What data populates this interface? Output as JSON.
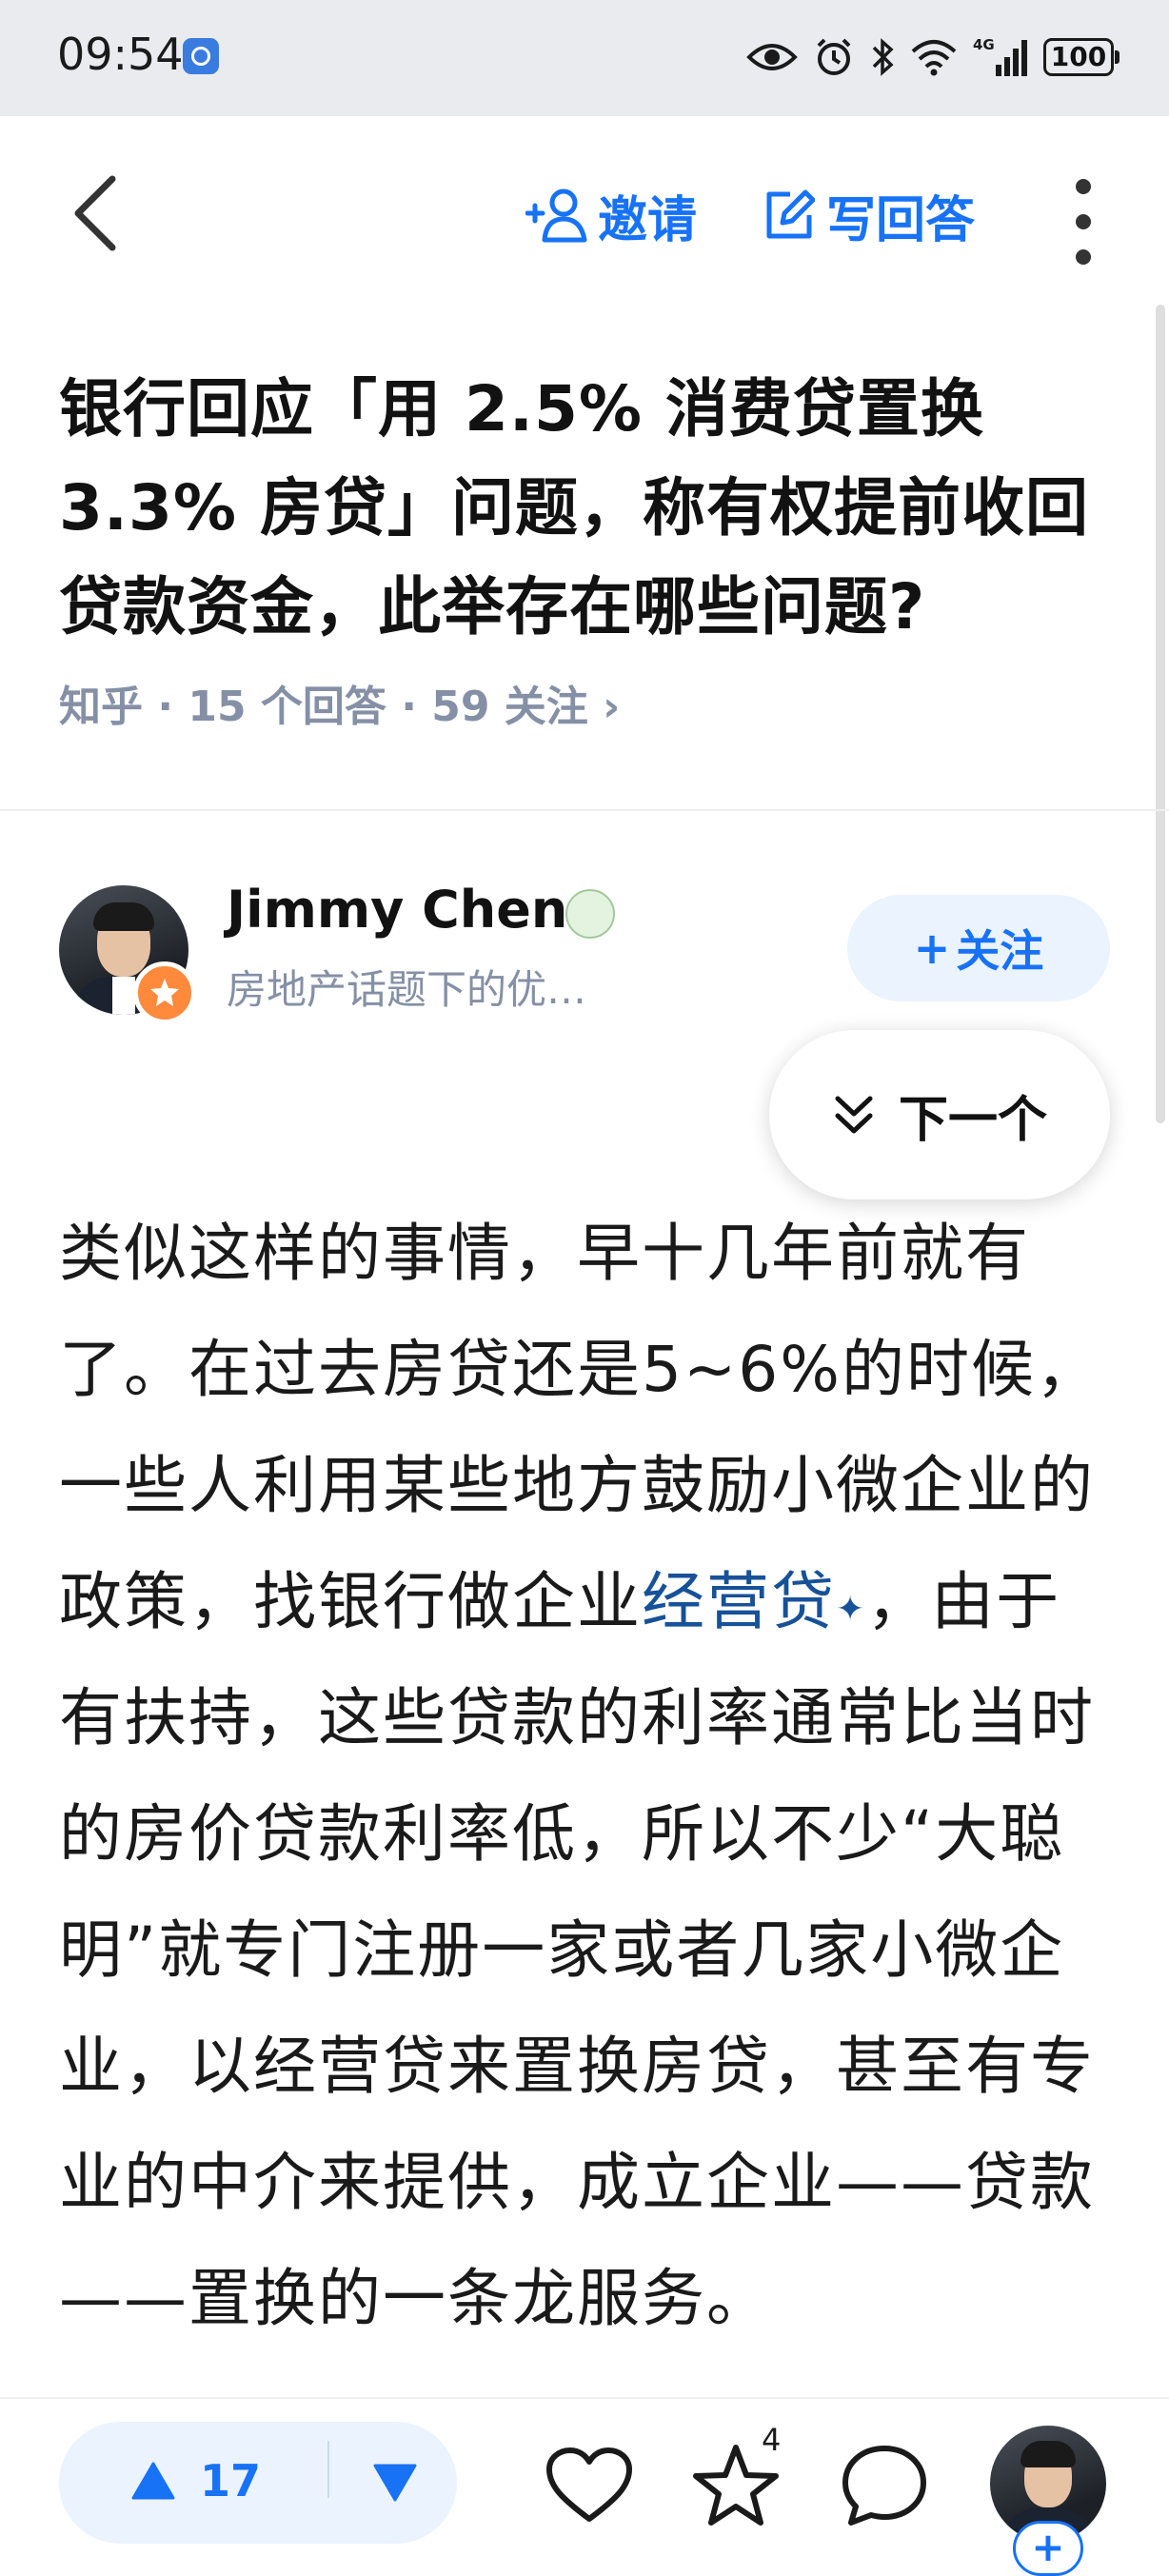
{
  "status_bar": {
    "time": "09:54",
    "signal_label": "4G",
    "battery": "100"
  },
  "nav": {
    "invite_label": "邀请",
    "write_answer_label": "写回答"
  },
  "question": {
    "title": "银行回应「用 2.5% 消费贷置换 3.3% 房贷」问题，称有权提前收回贷款资金，此举存在哪些问题?",
    "meta": "知乎 · 15 个回答 · 59 关注 ›"
  },
  "author": {
    "name": "Jimmy Chen",
    "description": "房地产话题下的优…",
    "follow_label": "关注",
    "follow_prefix": "+"
  },
  "next_button": {
    "label": "下一个"
  },
  "answer": {
    "text_before_link": "类似这样的事情，早十几年前就有了。在过去房贷还是5~6%的时候，一些人利用某些地方鼓励小微企业的政策，找银行做企业",
    "link_text": "经营贷",
    "link_mark": "✦",
    "text_after_link": "，由于有扶持，这些贷款的利率通常比当时的房价贷款利率低，所以不少“大聪明”就专门注册一家或者几家小微企业，以经营贷来置换房贷，甚至有专业的中介来提供，成立企业——贷款——置换的一条龙服务。"
  },
  "bottom_bar": {
    "upvote_count": "17",
    "favorite_count": "4",
    "plus_label": "+"
  },
  "colors": {
    "accent": "#1772f6",
    "link": "#175199",
    "meta_gray": "#8590a6",
    "status_bar_bg": "#e9ebef",
    "pill_bg": "#ebf3ff",
    "badge_orange": "#ff8a3c"
  },
  "icons": {
    "back": "chevron-left-icon",
    "invite": "add-user-icon",
    "write": "edit-icon",
    "more": "more-vertical-icon",
    "next": "double-chevron-down-icon",
    "upvote": "triangle-up-icon",
    "downvote": "triangle-down-icon",
    "like": "heart-icon",
    "favorite": "star-icon",
    "comment": "comment-bubble-icon"
  }
}
